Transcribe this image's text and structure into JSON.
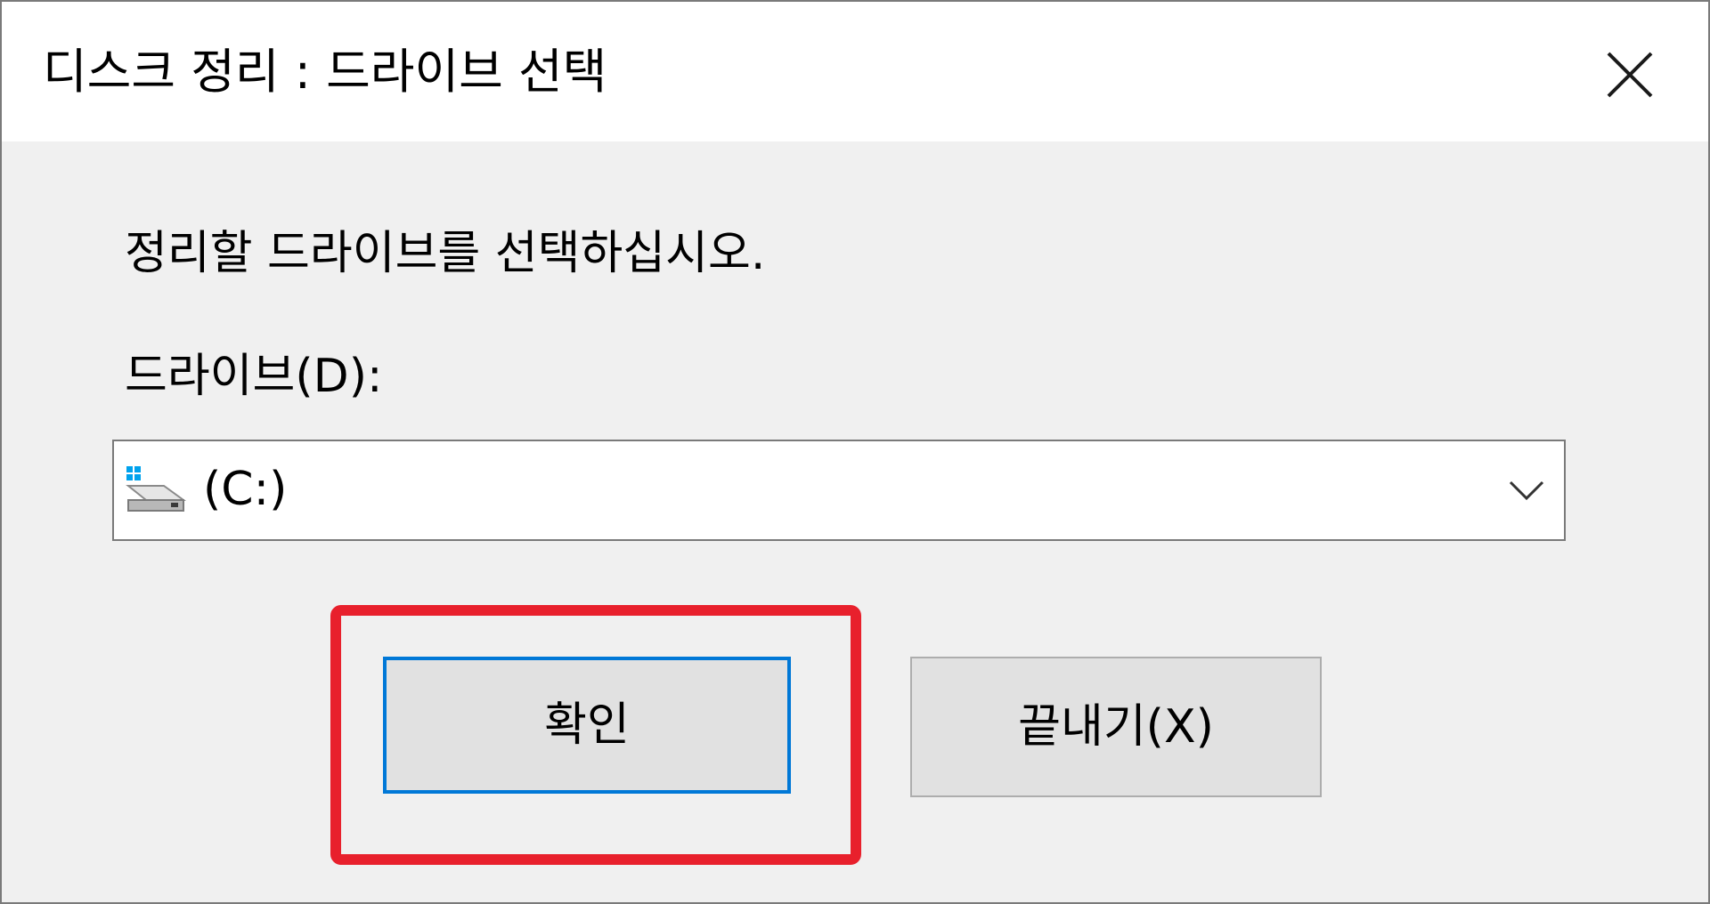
{
  "window": {
    "title": "디스크 정리 : 드라이브 선택"
  },
  "dialog": {
    "instruction": "정리할 드라이브를 선택하십시오.",
    "drive_label": "드라이브(D):",
    "drive_select": {
      "selected_value": "(C:)",
      "icon": "windows-drive-icon"
    }
  },
  "buttons": {
    "ok_label": "확인",
    "exit_label": "끝내기(X)"
  },
  "colors": {
    "focus_border": "#0078d7",
    "highlight_frame": "#e8202c",
    "window_background": "#f0f0f0"
  }
}
